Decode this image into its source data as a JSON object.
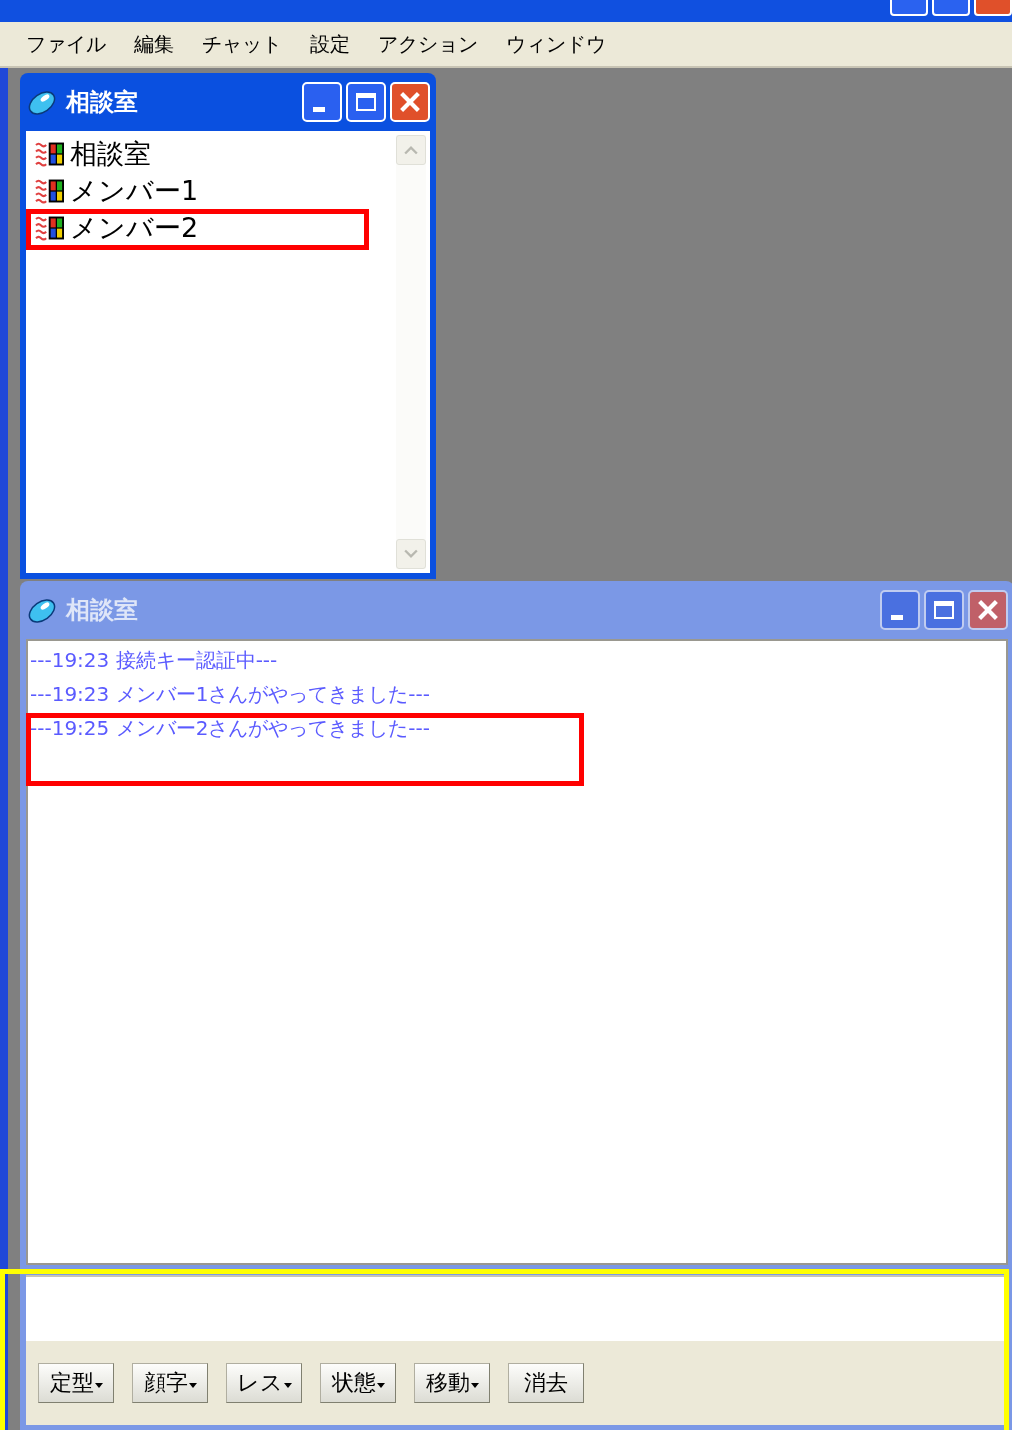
{
  "menu": [
    {
      "label": "ファイル"
    },
    {
      "label": "編集"
    },
    {
      "label": "チャット"
    },
    {
      "label": "設定"
    },
    {
      "label": "アクション"
    },
    {
      "label": "ウィンドウ"
    }
  ],
  "member_window": {
    "title": "相談室",
    "active": true,
    "items": [
      {
        "label": "相談室"
      },
      {
        "label": "メンバー1"
      },
      {
        "label": "メンバー2"
      }
    ]
  },
  "chat_window": {
    "title": "相談室",
    "active": false,
    "log": [
      "---19:23  接続キー認証中---",
      "---19:23  メンバー1さんがやってきました---",
      "---19:25  メンバー2さんがやってきました---"
    ],
    "buttons": [
      {
        "label": "定型",
        "has_menu": true
      },
      {
        "label": "顔字",
        "has_menu": true
      },
      {
        "label": "レス",
        "has_menu": true
      },
      {
        "label": "状態",
        "has_menu": true
      },
      {
        "label": "移動",
        "has_menu": true
      },
      {
        "label": "消去",
        "has_menu": false
      }
    ]
  },
  "highlights": [
    {
      "color": "#ff0000"
    },
    {
      "color": "#ff0000"
    },
    {
      "color": "#ffff00"
    }
  ]
}
